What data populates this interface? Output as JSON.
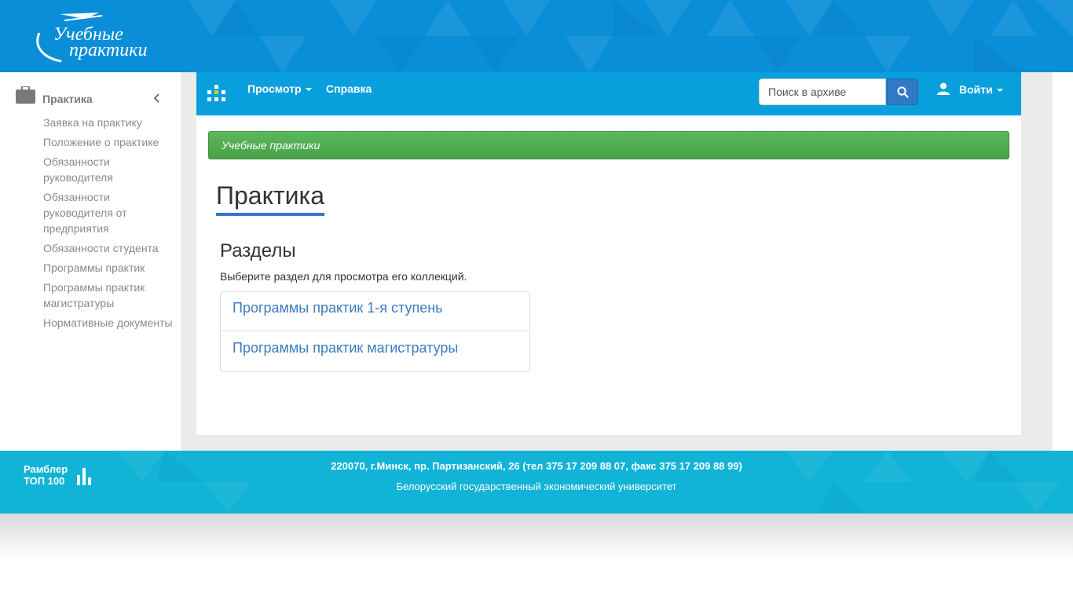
{
  "header": {
    "logo_line1": "Учебные",
    "logo_line2": "практики"
  },
  "sidebar": {
    "title": "Практика",
    "items": [
      {
        "label": "Заявка на практику"
      },
      {
        "label": "Положение о практике"
      },
      {
        "label": "Обязанности руководителя"
      },
      {
        "label": "Обязанности руководителя от предприятия"
      },
      {
        "label": "Обязанности студента"
      },
      {
        "label": "Программы практик"
      },
      {
        "label": "Программы практик магистратуры"
      },
      {
        "label": "Нормативные документы"
      }
    ]
  },
  "navbar": {
    "browse_label": "Просмотр",
    "help_label": "Справка",
    "search_placeholder": "Поиск в архиве",
    "login_label": "Войти"
  },
  "breadcrumb": {
    "label": "Учебные практики"
  },
  "main": {
    "title": "Практика",
    "section_title": "Разделы",
    "section_description": "Выберите раздел для просмотра его коллекций.",
    "sections": [
      {
        "label": "Программы практик 1-я ступень"
      },
      {
        "label": "Программы практик магистратуры"
      }
    ]
  },
  "footer": {
    "rambler_line1": "Рамблер",
    "rambler_line2": "ТОП 100",
    "address": "220070, г.Минск, пр. Партизанский, 26 (тел 375 17 209 88 07, факс 375 17 209 88 99)",
    "university": "Белорусский государственный экономический университет"
  },
  "colors": {
    "header_bg": "#0b8ed8",
    "navbar_bg": "#079fdc",
    "breadcrumb_bg": "#5cb85c",
    "link": "#3a7dbf",
    "accent_underline": "#3179c2",
    "footer_bg": "#11b3d6"
  }
}
